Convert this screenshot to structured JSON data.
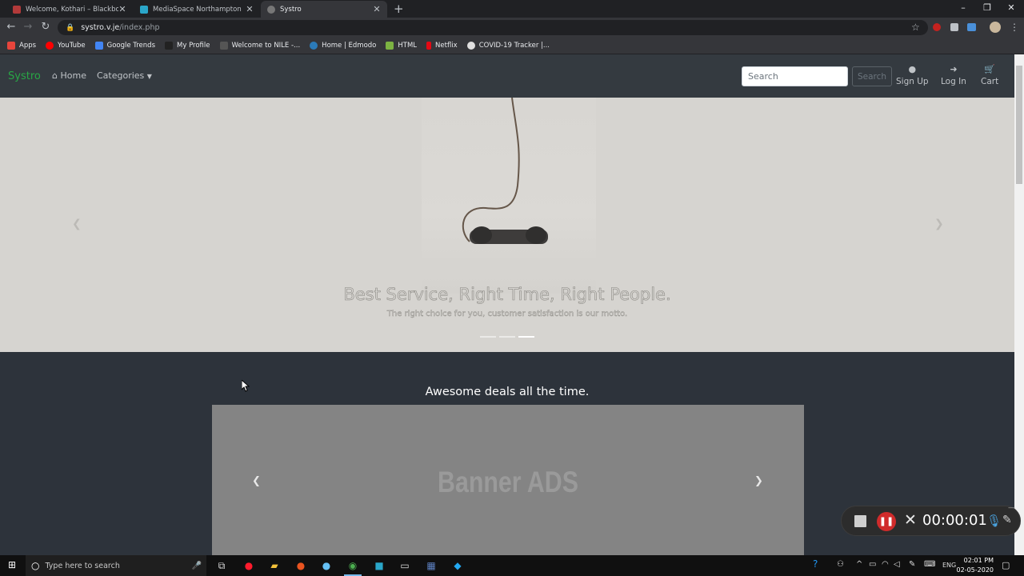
{
  "browser": {
    "tabs": [
      {
        "label": "Welcome, Kothari – Blackboard L",
        "icon": "blackboard-icon",
        "active": false
      },
      {
        "label": "MediaSpace Northampton",
        "icon": "mediaspace-icon",
        "active": false
      },
      {
        "label": "Systro",
        "icon": "globe-icon",
        "active": true
      }
    ],
    "new_tab": "+",
    "url_host": "systro.v.je",
    "url_path": "/index.php",
    "bookmarks": [
      {
        "label": "Apps",
        "color": "#e8453c"
      },
      {
        "label": "YouTube",
        "color": "#ff0000"
      },
      {
        "label": "Google Trends",
        "color": "#4285f4"
      },
      {
        "label": "My Profile",
        "color": "#222222"
      },
      {
        "label": "Welcome to NILE -...",
        "color": "#555555"
      },
      {
        "label": "Home | Edmodo",
        "color": "#2b7bb9"
      },
      {
        "label": "HTML",
        "color": "#7cb342"
      },
      {
        "label": "Netflix",
        "color": "#e50914"
      },
      {
        "label": "COVID-19 Tracker |...",
        "color": "#e0e0e0"
      }
    ]
  },
  "site": {
    "brand": "Systro",
    "nav": {
      "home": "Home",
      "categories": "Categories",
      "search_placeholder": "Search",
      "search_button": "Search",
      "signup": "Sign Up",
      "login": "Log In",
      "cart": "Cart"
    },
    "hero": {
      "title": "Best Service, Right Time, Right People.",
      "subtitle": "The right choice for you, customer satisfaction is our motto.",
      "slide_count": 3,
      "active_slide": 3
    },
    "deals": {
      "heading": "Awesome deals all the time.",
      "banner_text": "Banner ADS"
    },
    "accent": "#28a745"
  },
  "recorder": {
    "timer": "00:00:01"
  },
  "taskbar": {
    "search_placeholder": "Type here to search",
    "lang": "ENG",
    "time": "02:01 PM",
    "date": "02-05-2020"
  }
}
